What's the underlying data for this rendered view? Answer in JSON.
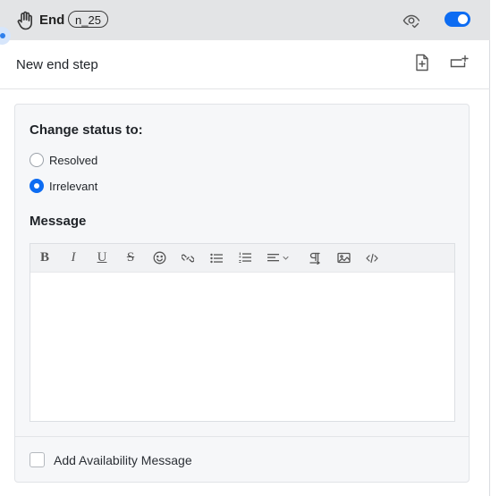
{
  "header": {
    "title": "End",
    "badge": "n_25",
    "toggle_on": true
  },
  "step": {
    "title": "New end step"
  },
  "form": {
    "status_label": "Change status to:",
    "options": [
      {
        "label": "Resolved",
        "checked": false
      },
      {
        "label": "Irrelevant",
        "checked": true
      }
    ],
    "message_label": "Message",
    "message_value": "",
    "toolbar": [
      {
        "icon": "bold-icon",
        "glyph": "B"
      },
      {
        "icon": "italic-icon",
        "glyph": "I"
      },
      {
        "icon": "underline-icon",
        "glyph": "U"
      },
      {
        "icon": "strikethrough-icon",
        "glyph": "S"
      },
      {
        "icon": "emoji-icon"
      },
      {
        "icon": "link-icon"
      },
      {
        "icon": "bulleted-list-icon"
      },
      {
        "icon": "numbered-list-icon"
      },
      {
        "icon": "align-icon"
      },
      {
        "icon": "paragraph-icon"
      },
      {
        "icon": "image-icon"
      },
      {
        "icon": "code-icon"
      }
    ],
    "availability_label": "Add Availability Message",
    "availability_checked": false
  },
  "colors": {
    "accent": "#0d6cf2",
    "header_bg": "#e3e4e6",
    "card_bg": "#f6f7f9"
  }
}
